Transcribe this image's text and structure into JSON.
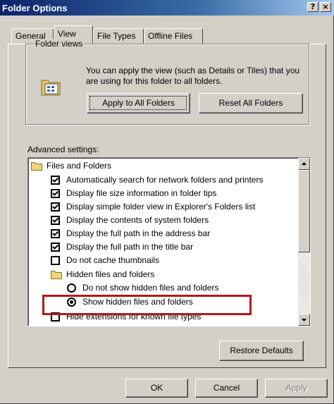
{
  "window": {
    "title": "Folder Options",
    "help_label": "?",
    "close_label": "×"
  },
  "tabs": [
    {
      "label": "General",
      "active": false
    },
    {
      "label": "View",
      "active": true
    },
    {
      "label": "File Types",
      "active": false
    },
    {
      "label": "Offline Files",
      "active": false
    }
  ],
  "folder_views": {
    "legend": "Folder views",
    "description": "You can apply the view (such as Details or Tiles) that you are using for this folder to all folders.",
    "apply_button": "Apply to All Folders",
    "reset_button": "Reset All Folders",
    "icon": "folder-options-icon"
  },
  "advanced": {
    "label": "Advanced settings:",
    "items": [
      {
        "type": "folder",
        "label": "Files and Folders",
        "indent": 0
      },
      {
        "type": "checkbox",
        "label": "Automatically search for network folders and printers",
        "checked": true
      },
      {
        "type": "checkbox",
        "label": "Display file size information in folder tips",
        "checked": true
      },
      {
        "type": "checkbox",
        "label": "Display simple folder view in Explorer's Folders list",
        "checked": true
      },
      {
        "type": "checkbox",
        "label": "Display the contents of system folders",
        "checked": true
      },
      {
        "type": "checkbox",
        "label": "Display the full path in the address bar",
        "checked": true
      },
      {
        "type": "checkbox",
        "label": "Display the full path in the title bar",
        "checked": true
      },
      {
        "type": "checkbox",
        "label": "Do not cache thumbnails",
        "checked": false
      },
      {
        "type": "folder",
        "label": "Hidden files and folders",
        "indent": 1
      },
      {
        "type": "radio",
        "label": "Do not show hidden files and folders",
        "selected": false
      },
      {
        "type": "radio",
        "label": "Show hidden files and folders",
        "selected": true
      },
      {
        "type": "checkbox",
        "label": "Hide extensions for known file types",
        "checked": false
      }
    ]
  },
  "buttons": {
    "restore_defaults": "Restore Defaults",
    "ok": "OK",
    "cancel": "Cancel",
    "apply": "Apply"
  },
  "colors": {
    "highlight_border": "#b01a1a",
    "title_gradient_start": "#0a246a",
    "disabled_text": "#808080"
  }
}
